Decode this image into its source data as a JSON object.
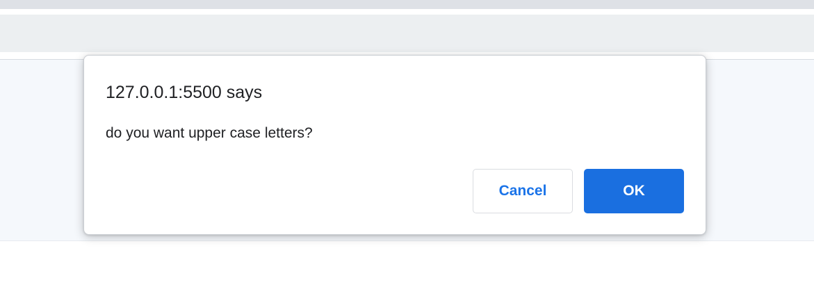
{
  "dialog": {
    "title": "127.0.0.1:5500 says",
    "message": "do you want upper case letters?",
    "cancel_label": "Cancel",
    "ok_label": "OK"
  },
  "colors": {
    "primary_button": "#1a6fe0",
    "link_blue": "#1a73e8",
    "text": "#202124",
    "toolbar": "#eceff1",
    "tabstrip": "#dee1e6"
  }
}
